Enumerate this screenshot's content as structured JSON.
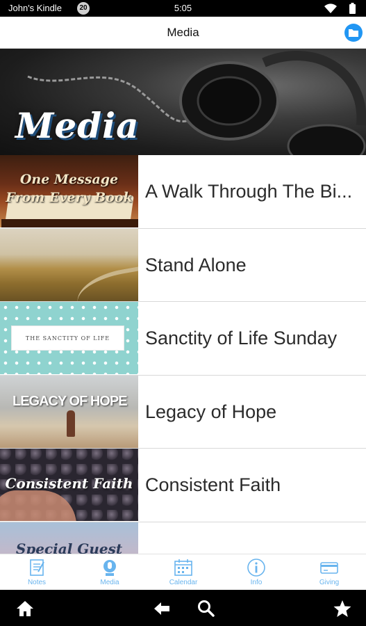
{
  "status_bar": {
    "owner": "John's Kindle",
    "notification_count": "20",
    "time": "5:05",
    "icons": [
      "wifi-icon",
      "battery-icon"
    ]
  },
  "header": {
    "title": "Media",
    "action_icon": "folder-icon",
    "accent_color": "#2196f3"
  },
  "hero": {
    "title": "Media"
  },
  "media_items": [
    {
      "label": "A Walk Through The Bi...",
      "thumb_text": "One Message From Every Book"
    },
    {
      "label": "Stand Alone",
      "thumb_text": ""
    },
    {
      "label": "Sanctity of Life Sunday",
      "thumb_text": "THE SANCTITY OF LIFE"
    },
    {
      "label": "Legacy of Hope",
      "thumb_text": "LEGACY OF HOPE"
    },
    {
      "label": "Consistent Faith",
      "thumb_text": "Consistent Faith"
    },
    {
      "label": "",
      "thumb_text": "Special Guest"
    }
  ],
  "tabs": [
    {
      "label": "Notes",
      "icon": "notes-icon"
    },
    {
      "label": "Media",
      "icon": "microphone-icon",
      "active": true
    },
    {
      "label": "Calendar",
      "icon": "calendar-icon"
    },
    {
      "label": "Info",
      "icon": "info-icon"
    },
    {
      "label": "Giving",
      "icon": "credit-card-icon"
    }
  ],
  "tab_color": "#68b4ee",
  "nav_bar": {
    "buttons": [
      "home-icon",
      "back-arrow-icon",
      "search-icon",
      "star-icon"
    ]
  }
}
